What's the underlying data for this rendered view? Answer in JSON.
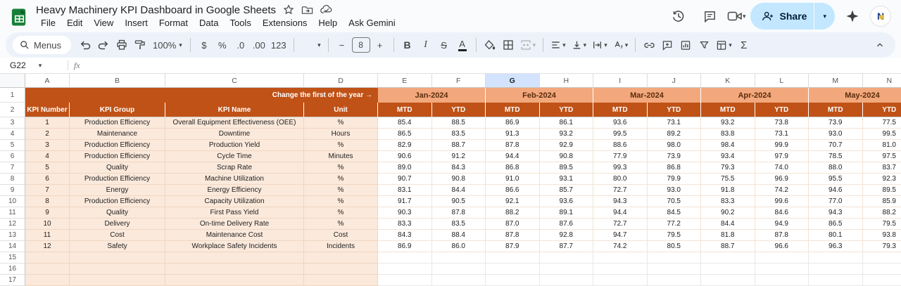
{
  "titlebar": {
    "title": "Heavy Machinery KPI Dashboard in Google Sheets",
    "menus": [
      "File",
      "Edit",
      "View",
      "Insert",
      "Format",
      "Data",
      "Tools",
      "Extensions",
      "Help",
      "Ask Gemini"
    ],
    "share_label": "Share"
  },
  "toolbar": {
    "menus_label": "Menus",
    "zoom_value": "100%",
    "number_formats": [
      "$",
      "%",
      ".0",
      ".00",
      "123"
    ],
    "font_size": "8",
    "bold_label": "B",
    "italic_label": "I",
    "strike_label": "S",
    "text_color_label": "A",
    "sum_label": "Σ"
  },
  "formula_bar": {
    "cell_ref": "G22",
    "fx_label": "fx"
  },
  "sheet": {
    "selected_column": "G",
    "columns": [
      "A",
      "B",
      "C",
      "D",
      "E",
      "F",
      "G",
      "H",
      "I",
      "J",
      "K",
      "L",
      "M",
      "N"
    ],
    "banner_label": "Change the first of the year →",
    "months": [
      "Jan-2024",
      "Feb-2024",
      "Mar-2024",
      "Apr-2024",
      "May-2024"
    ],
    "header_labels": [
      "KPI Number",
      "KPI Group",
      "KPI Name",
      "Unit"
    ],
    "mtd_label": "MTD",
    "ytd_label": "YTD",
    "rows": [
      {
        "n": "1",
        "group": "Production Efficiency",
        "name": "Overall Equipment Effectiveness (OEE)",
        "unit": "%",
        "values": [
          "85.4",
          "88.5",
          "86.9",
          "86.1",
          "93.6",
          "73.1",
          "93.2",
          "73.8",
          "73.9",
          "77.5"
        ]
      },
      {
        "n": "2",
        "group": "Maintenance",
        "name": "Downtime",
        "unit": "Hours",
        "values": [
          "86.5",
          "83.5",
          "91.3",
          "93.2",
          "99.5",
          "89.2",
          "83.8",
          "73.1",
          "93.0",
          "99.5"
        ]
      },
      {
        "n": "3",
        "group": "Production Efficiency",
        "name": "Production Yield",
        "unit": "%",
        "values": [
          "82.9",
          "88.7",
          "87.8",
          "92.9",
          "88.6",
          "98.0",
          "98.4",
          "99.9",
          "70.7",
          "81.0"
        ]
      },
      {
        "n": "4",
        "group": "Production Efficiency",
        "name": "Cycle Time",
        "unit": "Minutes",
        "values": [
          "90.6",
          "91.2",
          "94.4",
          "90.8",
          "77.9",
          "73.9",
          "93.4",
          "97.9",
          "78.5",
          "97.5"
        ]
      },
      {
        "n": "5",
        "group": "Quality",
        "name": "Scrap Rate",
        "unit": "%",
        "values": [
          "89.0",
          "84.3",
          "86.8",
          "89.5",
          "99.3",
          "86.8",
          "79.3",
          "74.0",
          "88.0",
          "83.7"
        ]
      },
      {
        "n": "6",
        "group": "Production Efficiency",
        "name": "Machine Utilization",
        "unit": "%",
        "values": [
          "90.7",
          "90.8",
          "91.0",
          "93.1",
          "80.0",
          "79.9",
          "75.5",
          "96.9",
          "95.5",
          "92.3"
        ]
      },
      {
        "n": "7",
        "group": "Energy",
        "name": "Energy Efficiency",
        "unit": "%",
        "values": [
          "83.1",
          "84.4",
          "86.6",
          "85.7",
          "72.7",
          "93.0",
          "91.8",
          "74.2",
          "94.6",
          "89.5"
        ]
      },
      {
        "n": "8",
        "group": "Production Efficiency",
        "name": "Capacity Utilization",
        "unit": "%",
        "values": [
          "91.7",
          "90.5",
          "92.1",
          "93.6",
          "94.3",
          "70.5",
          "83.3",
          "99.6",
          "77.0",
          "85.9"
        ]
      },
      {
        "n": "9",
        "group": "Quality",
        "name": "First Pass Yield",
        "unit": "%",
        "values": [
          "90.3",
          "87.8",
          "88.2",
          "89.1",
          "94.4",
          "84.5",
          "90.2",
          "84.6",
          "94.3",
          "88.2"
        ]
      },
      {
        "n": "10",
        "group": "Delivery",
        "name": "On-time Delivery Rate",
        "unit": "%",
        "values": [
          "83.3",
          "83.5",
          "87.0",
          "87.6",
          "72.7",
          "77.2",
          "84.4",
          "94.9",
          "86.5",
          "79.5"
        ]
      },
      {
        "n": "11",
        "group": "Cost",
        "name": "Maintenance Cost",
        "unit": "Cost",
        "values": [
          "84.3",
          "88.4",
          "87.8",
          "92.8",
          "94.7",
          "79.5",
          "81.8",
          "87.8",
          "80.1",
          "93.8"
        ]
      },
      {
        "n": "12",
        "group": "Safety",
        "name": "Workplace Safety Incidents",
        "unit": "Incidents",
        "values": [
          "86.9",
          "86.0",
          "87.9",
          "87.7",
          "74.2",
          "80.5",
          "88.7",
          "96.6",
          "96.3",
          "79.3"
        ]
      }
    ],
    "empty_row_numbers": [
      "15",
      "16",
      "17"
    ]
  },
  "colors": {
    "header_orange": "#C05217",
    "month_band": "#F2A87C",
    "month_text": "#5B2C0C",
    "cell_peach": "#FBE9DB",
    "peach_border": "#EFD6C2",
    "value_border": "#F3E3D5",
    "selected_col": "#D3E3FD",
    "share_bg": "#C2E7FF",
    "share_text": "#001D35",
    "logo_green": "#188038"
  }
}
